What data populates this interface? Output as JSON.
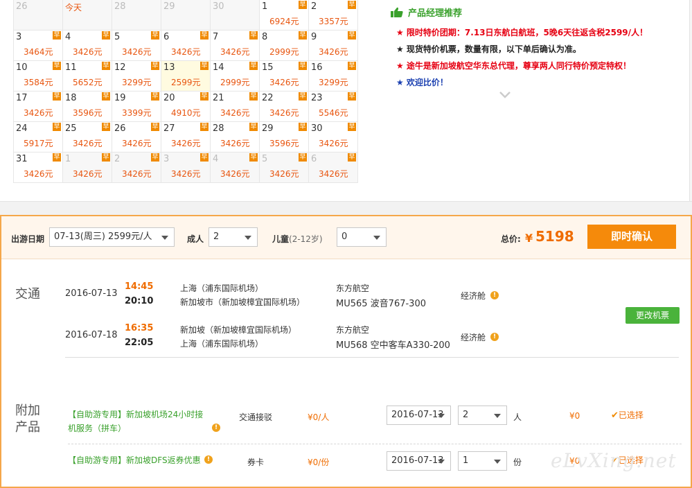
{
  "calendar": {
    "badge": "早",
    "rows": [
      [
        {
          "d": "26",
          "dis": true
        },
        {
          "d": "今天",
          "dis": true,
          "today": true
        },
        {
          "d": "28",
          "dis": true
        },
        {
          "d": "29",
          "dis": true
        },
        {
          "d": "30",
          "dis": true
        },
        {
          "d": "1",
          "p": "6924元"
        },
        {
          "d": "2",
          "p": "3357元"
        }
      ],
      [
        {
          "d": "3",
          "p": "3464元"
        },
        {
          "d": "4",
          "p": "3426元"
        },
        {
          "d": "5",
          "p": "3426元"
        },
        {
          "d": "6",
          "p": "3426元"
        },
        {
          "d": "7",
          "p": "3426元"
        },
        {
          "d": "8",
          "p": "2999元"
        },
        {
          "d": "9",
          "p": "3426元"
        }
      ],
      [
        {
          "d": "10",
          "p": "3584元"
        },
        {
          "d": "11",
          "p": "5652元"
        },
        {
          "d": "12",
          "p": "3299元"
        },
        {
          "d": "13",
          "p": "2599元",
          "sel": true
        },
        {
          "d": "14",
          "p": "2999元"
        },
        {
          "d": "15",
          "p": "3426元"
        },
        {
          "d": "16",
          "p": "3299元"
        }
      ],
      [
        {
          "d": "17",
          "p": "3426元"
        },
        {
          "d": "18",
          "p": "3596元"
        },
        {
          "d": "19",
          "p": "3399元"
        },
        {
          "d": "20",
          "p": "4910元"
        },
        {
          "d": "21",
          "p": "3426元"
        },
        {
          "d": "22",
          "p": "3426元"
        },
        {
          "d": "23",
          "p": "5546元"
        }
      ],
      [
        {
          "d": "24",
          "p": "5917元"
        },
        {
          "d": "25",
          "p": "3426元"
        },
        {
          "d": "26",
          "p": "3426元"
        },
        {
          "d": "27",
          "p": "3426元"
        },
        {
          "d": "28",
          "p": "3426元"
        },
        {
          "d": "29",
          "p": "3596元"
        },
        {
          "d": "30",
          "p": "3426元"
        }
      ],
      [
        {
          "d": "31",
          "p": "3426元"
        },
        {
          "d": "1",
          "p": "3426元",
          "dis": true
        },
        {
          "d": "2",
          "p": "3426元",
          "dis": true
        },
        {
          "d": "3",
          "p": "3426元",
          "dis": true
        },
        {
          "d": "4",
          "p": "3426元",
          "dis": true
        },
        {
          "d": "5",
          "p": "3426元",
          "dis": true
        },
        {
          "d": "6",
          "p": "3426元",
          "dis": true
        }
      ]
    ]
  },
  "recommend": {
    "title": "产品经理推荐",
    "lines": [
      {
        "text": "★ 限时特价团期：7.13日东航白航班，5晚6天往返含税2599/人！",
        "color": "red"
      },
      {
        "text": "★ 现货特价机票，数量有限，以下单后确认为准。",
        "color": "black"
      },
      {
        "text": "★ 途牛是新加坡航空华东总代理，尊享两人同行特价预定特权！",
        "color": "red"
      },
      {
        "text": "★ 欢迎比价！",
        "color": "blue"
      }
    ]
  },
  "booking": {
    "date_label": "出游日期",
    "date_value": "07-13(周三) 2599元/人",
    "adult_label": "成人",
    "adult_value": "2",
    "child_label": "儿童",
    "child_range": "(2-12岁)",
    "child_value": "0",
    "total_label": "总价:",
    "total_currency": "¥",
    "total_value": "5198",
    "confirm_label": "即时确认"
  },
  "transport": {
    "title": "交通",
    "change_label": "更改机票",
    "flights": [
      {
        "date": "2016-07-13",
        "dep_time": "14:45",
        "arr_time": "20:10",
        "from": "上海（浦东国际机场）",
        "to": "新加坡市（新加坡樟宜国际机场）",
        "airline": "东方航空",
        "flight": "MU565 波音767-300",
        "cabin": "经济舱"
      },
      {
        "date": "2016-07-18",
        "dep_time": "16:35",
        "arr_time": "22:05",
        "from": "新加坡（新加坡樟宜国际机场）",
        "to": "上海（浦东国际机场）",
        "airline": "东方航空",
        "flight": "MU568 空中客车A330-200",
        "cabin": "经济舱"
      }
    ]
  },
  "addons": {
    "title_line1": "附加",
    "title_line2": "产品",
    "items": [
      {
        "tag": "【自助游专用】",
        "name_line1": "新加坡机场24小时接",
        "name_line2": "机服务（拼车）",
        "type": "交通接驳",
        "price": "¥0/人",
        "date": "2016-07-13",
        "qty": "2",
        "unit": "人",
        "subtotal": "¥0",
        "status": "已选择"
      },
      {
        "tag": "【自助游专用】",
        "name_line1": "新加坡DFS返券优惠",
        "name_line2": "",
        "type": "券卡",
        "price": "¥0/份",
        "date": "2016-07-13",
        "qty": "1",
        "unit": "份",
        "subtotal": "¥0",
        "status": "已选择"
      }
    ]
  },
  "watermark": "eLvXing.net"
}
